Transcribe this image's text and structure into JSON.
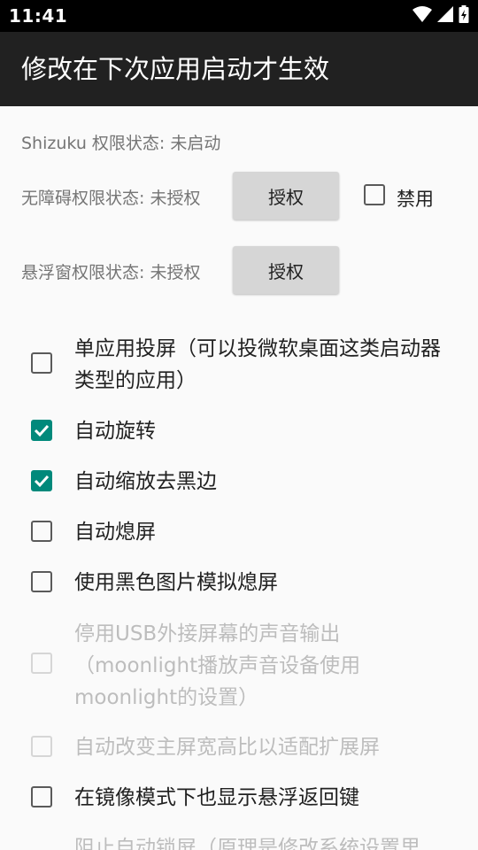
{
  "status_bar": {
    "time": "11:41"
  },
  "app_bar": {
    "title": "修改在下次应用启动才生效"
  },
  "permissions": {
    "shizuku_status": "Shizuku 权限状态: 未启动",
    "accessibility_status": "无障碍权限状态: 未授权",
    "accessibility_grant": "授权",
    "disable_label": "禁用",
    "disable_checked": false,
    "overlay_status": "悬浮窗权限状态: 未授权",
    "overlay_grant": "授权"
  },
  "options": [
    {
      "label": "单应用投屏（可以投微软桌面这类启动器类型的应用）",
      "checked": false,
      "enabled": true
    },
    {
      "label": "自动旋转",
      "checked": true,
      "enabled": true
    },
    {
      "label": "自动缩放去黑边",
      "checked": true,
      "enabled": true
    },
    {
      "label": "自动熄屏",
      "checked": false,
      "enabled": true
    },
    {
      "label": "使用黑色图片模拟熄屏",
      "checked": false,
      "enabled": true
    },
    {
      "label": "停用USB外接屏幕的声音输出（moonlight播放声音设备使用moonlight的设置）",
      "checked": false,
      "enabled": false
    },
    {
      "label": "自动改变主屏宽高比以适配扩展屏",
      "checked": false,
      "enabled": false
    },
    {
      "label": "在镜像模式下也显示悬浮返回键",
      "checked": false,
      "enabled": true
    },
    {
      "label": "阻止自动锁屏（原理是修改系统设置里",
      "checked": false,
      "enabled": false
    }
  ],
  "colors": {
    "accent": "#00897b",
    "app_bar": "#212121"
  }
}
